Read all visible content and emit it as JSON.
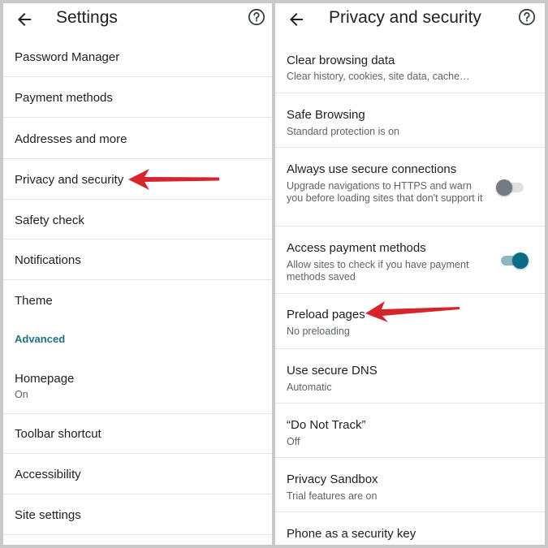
{
  "colors": {
    "accent": "#1a7381",
    "toggle_on": "#0b6c85",
    "toggle_off": "#757b80",
    "arrow": "#d6232c"
  },
  "left": {
    "title": "Settings",
    "back_icon": "back-arrow-icon",
    "help_icon": "help-icon",
    "items": [
      {
        "label": "Password Manager"
      },
      {
        "label": "Payment methods"
      },
      {
        "label": "Addresses and more"
      },
      {
        "label": "Privacy and security"
      },
      {
        "label": "Safety check"
      },
      {
        "label": "Notifications"
      },
      {
        "label": "Theme"
      }
    ],
    "section_label": "Advanced",
    "advanced_items": [
      {
        "label": "Homepage",
        "sub": "On"
      },
      {
        "label": "Toolbar shortcut"
      },
      {
        "label": "Accessibility"
      },
      {
        "label": "Site settings"
      }
    ]
  },
  "right": {
    "title": "Privacy and security",
    "back_icon": "back-arrow-icon",
    "help_icon": "help-icon",
    "items": [
      {
        "label": "Clear browsing data",
        "sub": "Clear history, cookies, site data, cache…"
      },
      {
        "label": "Safe Browsing",
        "sub": "Standard protection is on"
      },
      {
        "label": "Always use secure connections",
        "sub": "Upgrade navigations to HTTPS and warn you before loading sites that don't support it",
        "toggle": "off"
      },
      {
        "label": "Access payment methods",
        "sub": "Allow sites to check if you have payment methods saved",
        "toggle": "on"
      },
      {
        "label": "Preload pages",
        "sub": "No preloading"
      },
      {
        "label": "Use secure DNS",
        "sub": "Automatic"
      },
      {
        "label": "“Do Not Track”",
        "sub": "Off"
      },
      {
        "label": "Privacy Sandbox",
        "sub": "Trial features are on"
      },
      {
        "label": "Phone as a security key"
      }
    ]
  }
}
